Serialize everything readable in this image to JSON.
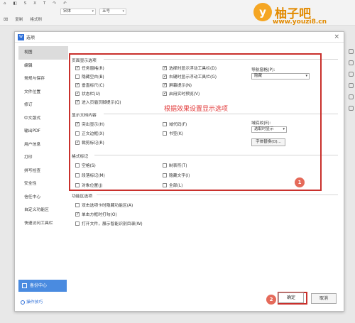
{
  "toolbar": {
    "row1": [
      "⌂",
      "◧",
      "S",
      "X",
      "T",
      "↷",
      "↶",
      "▢",
      "文件"
    ],
    "font": "宋体",
    "size": "五号",
    "row2": [
      "⌧",
      "复制",
      "格式刷"
    ]
  },
  "logo": {
    "mark": "y",
    "name": "柚子吧",
    "url": "www.youzi8.cn"
  },
  "dialog": {
    "title": "选项",
    "app_icon": "W",
    "close": "×"
  },
  "sidebar": [
    "视图",
    "编辑",
    "常规与保存",
    "文件位置",
    "修订",
    "中文版式",
    "输出PDF",
    "用户信息",
    "打印",
    "拼写检查",
    "安全性",
    "信任中心",
    "自定义功能区",
    "快速访问工具栏"
  ],
  "sidebar_active": "视图",
  "backup_label": "备份中心",
  "tips_label": "操作技巧",
  "sections": {
    "page_display": "页面显示选项",
    "doc_content": "显示文档内容",
    "format_marks": "格式标记",
    "ribbon": "功能区选项"
  },
  "page_display": {
    "col1": [
      {
        "label": "任务窗格(R)",
        "checked": true
      },
      {
        "label": "隐藏空白(B)",
        "checked": false
      },
      {
        "label": "垂直标尺(C)",
        "checked": true
      },
      {
        "label": "状态栏(U)",
        "checked": true
      },
      {
        "label": "进入页眉页脚提示(Q)",
        "checked": true
      }
    ],
    "col2": [
      {
        "label": "选择时显示浮动工具栏(D)",
        "checked": true
      },
      {
        "label": "右键时显示浮动工具栏(G)",
        "checked": true
      },
      {
        "label": "屏幕提示(N)",
        "checked": true
      },
      {
        "label": "启用实时预览(V)",
        "checked": true
      }
    ],
    "nav_pane_label": "导航窗格(P):",
    "nav_pane_value": "隐藏"
  },
  "doc_content": {
    "col1": [
      {
        "label": "突出显示(H)",
        "checked": true
      },
      {
        "label": "正文边框(X)",
        "checked": false
      },
      {
        "label": "裁剪标记(R)",
        "checked": true
      }
    ],
    "col2": [
      {
        "label": "域代码(F)",
        "checked": false
      },
      {
        "label": "书签(K)",
        "checked": false
      }
    ],
    "field_shading_label": "域底纹(E):",
    "field_shading_value": "选取时显示",
    "font_substitute": "字体替换(O)..."
  },
  "format_marks": {
    "col1": [
      {
        "label": "空格(S)",
        "checked": false
      },
      {
        "label": "段落标记(M)",
        "checked": false
      },
      {
        "label": "对象位置(J)",
        "checked": false
      }
    ],
    "col2": [
      {
        "label": "制表符(T)",
        "checked": false
      },
      {
        "label": "隐藏文字(I)",
        "checked": false
      },
      {
        "label": "全部(L)",
        "checked": false
      }
    ]
  },
  "ribbon": [
    {
      "label": "双击选项卡时隐藏功能区(A)",
      "checked": false
    },
    {
      "label": "单击方框时打勾(O)",
      "checked": true
    },
    {
      "label": "打开文件，展示智能识别目录(W)",
      "checked": false
    }
  ],
  "annotation": "根据效果设置显示选项",
  "badge1": "1",
  "badge2": "2",
  "ok_label": "确定",
  "cancel_label": "取消",
  "colors": {
    "accent": "#2e6fd8",
    "annotation": "#e23b3b",
    "highlight_box": "#c9302c",
    "logo": "#e28a00"
  }
}
